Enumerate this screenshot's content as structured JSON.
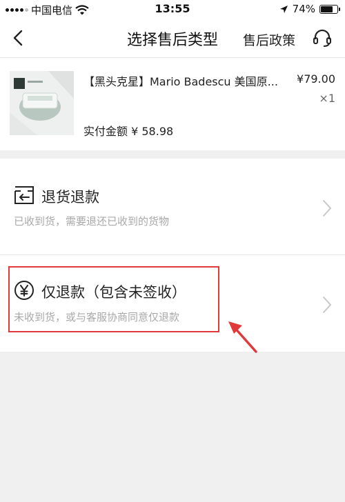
{
  "status_bar": {
    "carrier": "中国电信",
    "time": "13:55",
    "battery": "74%",
    "battery_level": 0.74,
    "icons": [
      "signal-icon",
      "wifi-icon",
      "location-arrow-icon",
      "battery-icon"
    ]
  },
  "nav": {
    "title": "选择售后类型",
    "policy_label": "售后政策",
    "icons": [
      "back-chevron-icon",
      "customer-service-headset-icon"
    ]
  },
  "product": {
    "name": "【黑头克星】Mario Badescu 美国原...",
    "price": "¥79.00",
    "quantity": "×1",
    "paid_label": "实付金额",
    "paid_amount": "¥ 58.98"
  },
  "options": [
    {
      "icon": "return-box-icon",
      "title": "退货退款",
      "desc": "已收到货，需要退还已收到的货物"
    },
    {
      "icon": "yen-circle-icon",
      "title": "仅退款（包含未签收）",
      "desc": "未收到货，或与客服协商同意仅退款"
    }
  ],
  "colors": {
    "highlight_border": "#e0393b",
    "background": "#f0f0f0",
    "muted_text": "#a8a8a8"
  }
}
